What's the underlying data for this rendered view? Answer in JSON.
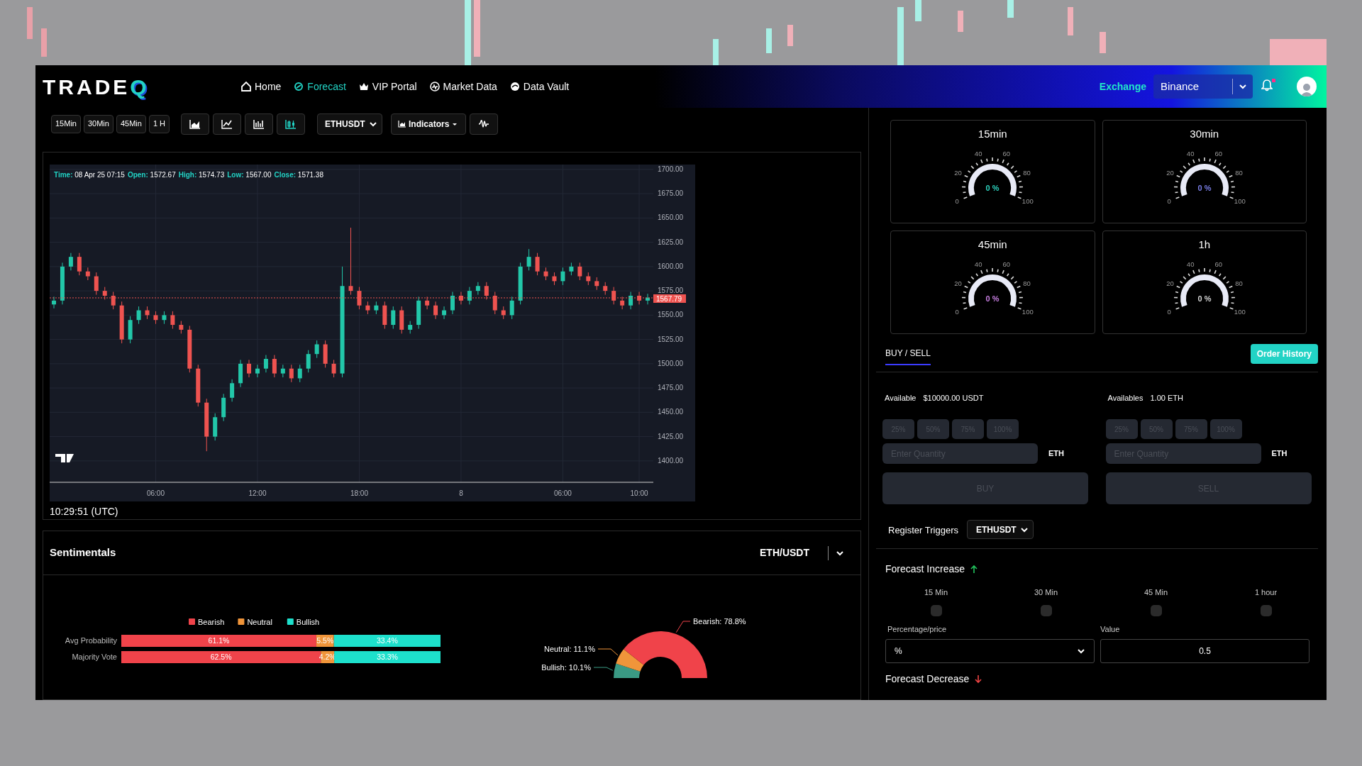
{
  "header": {
    "logo": {
      "text": "TRADE",
      "mark": "Q"
    },
    "nav": [
      {
        "label": "Home",
        "selected": false
      },
      {
        "label": "Forecast",
        "selected": true
      },
      {
        "label": "VIP Portal",
        "selected": false
      },
      {
        "label": "Market Data",
        "selected": false
      },
      {
        "label": "Data Vault",
        "selected": false
      }
    ],
    "exchange_label": "Exchange",
    "exchange": "Binance",
    "notification": true
  },
  "toolbar": {
    "intervals": [
      {
        "label": "15Min",
        "selected": false
      },
      {
        "label": "30Min",
        "selected": false
      },
      {
        "label": "45Min",
        "selected": false
      },
      {
        "label": "1 H",
        "selected": false
      }
    ],
    "chart_types": [
      {
        "kind": "area",
        "selected": false
      },
      {
        "kind": "line",
        "selected": false
      },
      {
        "kind": "bars",
        "selected": false
      },
      {
        "kind": "candles",
        "selected": true
      }
    ],
    "symbol": "ETHUSDT",
    "indicators": "Indicators"
  },
  "price_chart": {
    "legend": [
      {
        "label": "Time:",
        "value": "08 Apr 25 07:15"
      },
      {
        "label": "Open:",
        "value": "1572.67"
      },
      {
        "label": "High:",
        "value": "1574.73"
      },
      {
        "label": "Low:",
        "value": "1567.00"
      },
      {
        "label": "Close:",
        "value": "1571.38"
      }
    ],
    "chart_data": {
      "type": "candlestick",
      "grid": true,
      "ylim": [
        1378,
        1705
      ],
      "yticks": [
        {
          "value": 1700,
          "label": "1700.00"
        },
        {
          "value": 1675,
          "label": "1675.00"
        },
        {
          "value": 1650,
          "label": "1650.00"
        },
        {
          "value": 1625,
          "label": "1625.00"
        },
        {
          "value": 1600,
          "label": "1600.00"
        },
        {
          "value": 1575,
          "label": "1575.00"
        },
        {
          "value": 1550,
          "label": "1550.00"
        },
        {
          "value": 1525,
          "label": "1525.00"
        },
        {
          "value": 1500,
          "label": "1500.00"
        },
        {
          "value": 1475,
          "label": "1475.00"
        },
        {
          "value": 1450,
          "label": "1450.00"
        },
        {
          "value": 1425,
          "label": "1425.00"
        },
        {
          "value": 1400,
          "label": "1400.00"
        }
      ],
      "categories": [
        null,
        null,
        null,
        null,
        null,
        null,
        null,
        null,
        null,
        null,
        null,
        null,
        "06:00",
        null,
        null,
        null,
        null,
        null,
        null,
        null,
        null,
        null,
        null,
        null,
        "12:00",
        null,
        null,
        null,
        null,
        null,
        null,
        null,
        null,
        null,
        null,
        null,
        "18:00",
        null,
        null,
        null,
        null,
        null,
        null,
        null,
        null,
        null,
        null,
        null,
        "8",
        null,
        null,
        null,
        null,
        null,
        null,
        null,
        null,
        null,
        null,
        null,
        "06:00",
        null,
        null,
        null,
        null,
        null,
        null,
        null,
        null,
        "10:00",
        null
      ],
      "ohlc": [
        [
          1561,
          1569,
          1557,
          1565
        ],
        [
          1565,
          1604,
          1561,
          1600
        ],
        [
          1600,
          1614,
          1596,
          1610
        ],
        [
          1610,
          1614,
          1591,
          1595
        ],
        [
          1595,
          1599,
          1586,
          1590
        ],
        [
          1590,
          1594,
          1571,
          1575
        ],
        [
          1575,
          1579,
          1566,
          1570
        ],
        [
          1570,
          1574,
          1556,
          1560
        ],
        [
          1560,
          1564,
          1521,
          1525
        ],
        [
          1525,
          1549,
          1521,
          1545
        ],
        [
          1545,
          1559,
          1541,
          1555
        ],
        [
          1555,
          1559,
          1546,
          1550
        ],
        [
          1550,
          1554,
          1541,
          1545
        ],
        [
          1545,
          1554,
          1541,
          1550
        ],
        [
          1550,
          1554,
          1536,
          1540
        ],
        [
          1540,
          1544,
          1531,
          1535
        ],
        [
          1535,
          1539,
          1491,
          1495
        ],
        [
          1495,
          1499,
          1456,
          1460
        ],
        [
          1460,
          1464,
          1410,
          1425
        ],
        [
          1425,
          1449,
          1421,
          1445
        ],
        [
          1445,
          1469,
          1441,
          1465
        ],
        [
          1465,
          1484,
          1461,
          1480
        ],
        [
          1480,
          1504,
          1476,
          1500
        ],
        [
          1500,
          1504,
          1486,
          1490
        ],
        [
          1490,
          1499,
          1486,
          1495
        ],
        [
          1495,
          1509,
          1491,
          1505
        ],
        [
          1505,
          1509,
          1486,
          1490
        ],
        [
          1490,
          1499,
          1486,
          1495
        ],
        [
          1495,
          1499,
          1481,
          1485
        ],
        [
          1485,
          1499,
          1481,
          1495
        ],
        [
          1495,
          1514,
          1491,
          1510
        ],
        [
          1510,
          1524,
          1506,
          1520
        ],
        [
          1520,
          1524,
          1496,
          1500
        ],
        [
          1500,
          1504,
          1486,
          1490
        ],
        [
          1490,
          1600,
          1486,
          1580
        ],
        [
          1580,
          1640,
          1571,
          1575
        ],
        [
          1575,
          1579,
          1556,
          1560
        ],
        [
          1560,
          1564,
          1551,
          1555
        ],
        [
          1555,
          1564,
          1551,
          1560
        ],
        [
          1560,
          1564,
          1536,
          1540
        ],
        [
          1540,
          1559,
          1536,
          1555
        ],
        [
          1555,
          1559,
          1531,
          1535
        ],
        [
          1535,
          1544,
          1531,
          1540
        ],
        [
          1540,
          1569,
          1536,
          1565
        ],
        [
          1565,
          1569,
          1556,
          1560
        ],
        [
          1560,
          1564,
          1546,
          1550
        ],
        [
          1550,
          1559,
          1546,
          1555
        ],
        [
          1555,
          1574,
          1551,
          1570
        ],
        [
          1570,
          1574,
          1561,
          1565
        ],
        [
          1565,
          1579,
          1561,
          1575
        ],
        [
          1575,
          1584,
          1571,
          1580
        ],
        [
          1580,
          1584,
          1566,
          1570
        ],
        [
          1570,
          1574,
          1551,
          1555
        ],
        [
          1555,
          1559,
          1546,
          1550
        ],
        [
          1550,
          1569,
          1546,
          1565
        ],
        [
          1565,
          1604,
          1561,
          1600
        ],
        [
          1600,
          1618,
          1596,
          1610
        ],
        [
          1610,
          1614,
          1591,
          1595
        ],
        [
          1595,
          1599,
          1586,
          1590
        ],
        [
          1590,
          1594,
          1581,
          1585
        ],
        [
          1585,
          1599,
          1581,
          1595
        ],
        [
          1595,
          1604,
          1591,
          1600
        ],
        [
          1600,
          1604,
          1586,
          1590
        ],
        [
          1590,
          1594,
          1581,
          1585
        ],
        [
          1585,
          1589,
          1576,
          1580
        ],
        [
          1580,
          1584,
          1571,
          1575
        ],
        [
          1575,
          1579,
          1561,
          1565
        ],
        [
          1565,
          1569,
          1556,
          1560
        ],
        [
          1560,
          1574,
          1556,
          1570
        ],
        [
          1570,
          1574,
          1561,
          1565
        ],
        [
          1565,
          1572,
          1561,
          1568
        ]
      ],
      "ref_lines": [
        {
          "axis": "y",
          "value": 1567.79,
          "label": "1567.79",
          "color": "#ef5350"
        }
      ]
    }
  },
  "clock": "10:29:51 (UTC)",
  "sentimentals": {
    "title": "Sentimentals",
    "pair": "ETH/USDT",
    "bar_chart": {
      "chart_data": {
        "type": "bar",
        "orientation": "horizontal",
        "stacked": true,
        "legend": "top",
        "categories": [
          "Avg Probability",
          "Majority Vote"
        ],
        "series": [
          {
            "name": "Bearish",
            "color": "#f0434a",
            "values": [
              61.1,
              62.5
            ],
            "value_labels": [
              "61.1%",
              "62.5%"
            ]
          },
          {
            "name": "Neutral",
            "color": "#f0953a",
            "values": [
              5.5,
              4.2
            ],
            "value_labels": [
              "5.5%",
              "4.2%"
            ]
          },
          {
            "name": "Bullish",
            "color": "#1de0cc",
            "values": [
              33.4,
              33.3
            ],
            "value_labels": [
              "33.4%",
              "33.3%"
            ]
          }
        ]
      }
    },
    "donut": {
      "chart_data": {
        "type": "donut",
        "values": [
          78.8,
          11.1,
          10.1
        ],
        "colors": [
          "#f0434a",
          "#f0953a",
          "#3a9a84"
        ],
        "value_labels": [
          "Bearish: 78.8%",
          "Neutral: 11.1%",
          "Bullish: 10.1%"
        ]
      }
    }
  },
  "gauges": [
    {
      "title": "15min",
      "value": "0 %",
      "color": "#2dd4bf",
      "scale": [
        "0",
        "20",
        "40",
        "60",
        "80",
        "100"
      ]
    },
    {
      "title": "30min",
      "value": "0 %",
      "color": "#7b7fe8",
      "scale": [
        "0",
        "20",
        "40",
        "60",
        "80",
        "100"
      ]
    },
    {
      "title": "45min",
      "value": "0 %",
      "color": "#c77ee0",
      "scale": [
        "0",
        "20",
        "40",
        "60",
        "80",
        "100"
      ]
    },
    {
      "title": "1h",
      "value": "0 %",
      "color": "#d4d4d4",
      "scale": [
        "0",
        "20",
        "40",
        "60",
        "80",
        "100"
      ]
    }
  ],
  "trade": {
    "tab": {
      "label": "BUY / SELL",
      "selected": true
    },
    "order_history": "Order History",
    "sides": [
      {
        "available_label": "Available",
        "available": "$10000.00 USDT",
        "percents": [
          "25%",
          "50%",
          "75%",
          "100%"
        ],
        "placeholder": "Enter Quantity",
        "unit": "ETH",
        "action": "BUY",
        "disabled": true
      },
      {
        "available_label": "Availables",
        "available": "1.00 ETH",
        "percents": [
          "25%",
          "50%",
          "75%",
          "100%"
        ],
        "placeholder": "Enter Quantity",
        "unit": "ETH",
        "action": "SELL",
        "disabled": true
      }
    ],
    "triggers_label": "Register Triggers",
    "triggers_symbol": "ETHUSDT",
    "increase": {
      "title": "Forecast Increase",
      "intervals": [
        {
          "label": "15 Min",
          "checked": false
        },
        {
          "label": "30 Min",
          "checked": false
        },
        {
          "label": "45 Min",
          "checked": false
        },
        {
          "label": "1 hour",
          "checked": false
        }
      ],
      "mode_label": "Percentage/price",
      "mode": "%",
      "value_label": "Value",
      "value": "0.5"
    },
    "decrease": {
      "title": "Forecast Decrease"
    }
  }
}
